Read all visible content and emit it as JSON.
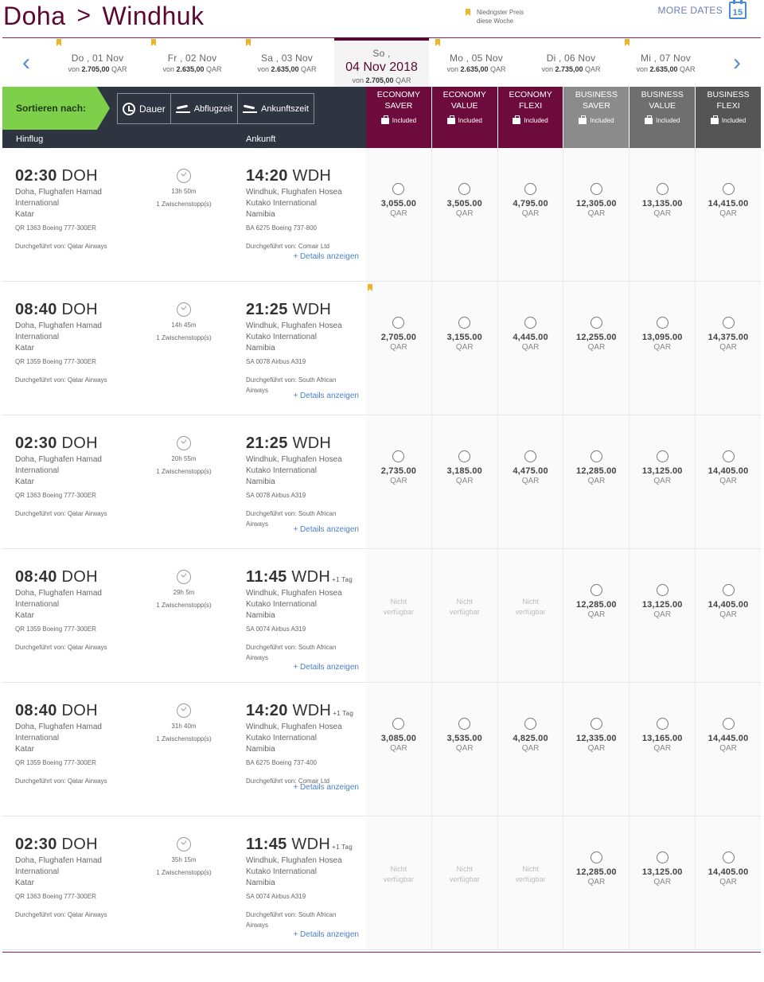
{
  "header": {
    "origin": "Doha",
    "separator": ">",
    "destination": "Windhuk",
    "lowest_price_label_1": "Niedrigster Preis",
    "lowest_price_label_2": "diese Woche",
    "more_dates": "MORE DATES",
    "calendar_day": "15"
  },
  "dates": [
    {
      "day": "Do , 01 Nov",
      "from": "von",
      "price": "2.705,00",
      "cur": "QAR",
      "bookmark": true
    },
    {
      "day": "Fr , 02 Nov",
      "from": "von",
      "price": "2.635,00",
      "cur": "QAR",
      "bookmark": true
    },
    {
      "day": "Sa , 03 Nov",
      "from": "von",
      "price": "2.635,00",
      "cur": "QAR",
      "bookmark": true
    },
    {
      "day": "So ,",
      "big": "04 Nov 2018",
      "from": "von",
      "price": "2.705,00",
      "cur": "QAR",
      "active": true
    },
    {
      "day": "Mo , 05 Nov",
      "from": "von",
      "price": "2.635,00",
      "cur": "QAR",
      "bookmark": true
    },
    {
      "day": "Di , 06 Nov",
      "from": "von",
      "price": "2.735,00",
      "cur": "QAR"
    },
    {
      "day": "Mi , 07 Nov",
      "from": "von",
      "price": "2.635,00",
      "cur": "QAR",
      "bookmark": true
    }
  ],
  "sort": {
    "label": "Sortieren nach:",
    "duration": "Dauer",
    "departure": "Abflugzeit",
    "arrival": "Ankunftszeit",
    "col_outbound": "Hinflug",
    "col_arrival": "Ankunft"
  },
  "fares": [
    {
      "l1": "ECONOMY",
      "l2": "SAVER",
      "inc": "Included",
      "cls": "eco"
    },
    {
      "l1": "ECONOMY",
      "l2": "VALUE",
      "inc": "Included",
      "cls": "eco"
    },
    {
      "l1": "ECONOMY",
      "l2": "FLEXI",
      "inc": "Included",
      "cls": "eco"
    },
    {
      "l1": "BUSINESS",
      "l2": "SAVER",
      "inc": "Included",
      "cls": "bus1"
    },
    {
      "l1": "BUSINESS",
      "l2": "VALUE",
      "inc": "Included",
      "cls": "bus2"
    },
    {
      "l1": "BUSINESS",
      "l2": "FLEXI",
      "inc": "Included",
      "cls": "bus3"
    }
  ],
  "currency": "QAR",
  "not_available_1": "Nicht",
  "not_available_2": "verfügbar",
  "details_label": "+ Details anzeigen",
  "flights": [
    {
      "dep_time": "02:30",
      "dep_code": "DOH",
      "dep_place": [
        "Doha, Flughafen Hamad",
        "International",
        "Katar"
      ],
      "dep_flight": "QR 1363 Boeing 777-300ER",
      "dep_operator": [
        "Durchgeführt von: Qatar Airways"
      ],
      "duration": "13h 50m",
      "stops": "1 Zwischenstopp(s)",
      "arr_time": "14:20",
      "arr_code": "WDH",
      "arr_plus": "",
      "arr_place": [
        "Windhuk, Flughafen Hosea",
        "Kutako International",
        "Namibia"
      ],
      "arr_flight": "BA 6275 Boeing 737-800",
      "arr_operator": [
        "Durchgeführt von: Comair Ltd"
      ],
      "prices": [
        "3,055.00",
        "3,505.00",
        "4,795.00",
        "12,305.00",
        "13,135.00",
        "14,415.00"
      ],
      "bookmark": false
    },
    {
      "dep_time": "08:40",
      "dep_code": "DOH",
      "dep_place": [
        "Doha, Flughafen Hamad",
        "International",
        "Katar"
      ],
      "dep_flight": "QR 1359 Boeing 777-300ER",
      "dep_operator": [
        "Durchgeführt von: Qatar Airways"
      ],
      "duration": "14h 45m",
      "stops": "1 Zwischenstopp(s)",
      "arr_time": "21:25",
      "arr_code": "WDH",
      "arr_plus": "",
      "arr_place": [
        "Windhuk, Flughafen Hosea",
        "Kutako International",
        "Namibia"
      ],
      "arr_flight": "SA 0078 Airbus A319",
      "arr_operator": [
        "Durchgeführt von: South African",
        "Airways"
      ],
      "prices": [
        "2,705.00",
        "3,155.00",
        "4,445.00",
        "12,255.00",
        "13,095.00",
        "14,375.00"
      ],
      "bookmark": true
    },
    {
      "dep_time": "02:30",
      "dep_code": "DOH",
      "dep_place": [
        "Doha, Flughafen Hamad",
        "International",
        "Katar"
      ],
      "dep_flight": "QR 1363 Boeing 777-300ER",
      "dep_operator": [
        "Durchgeführt von: Qatar Airways"
      ],
      "duration": "20h 55m",
      "stops": "1 Zwischenstopp(s)",
      "arr_time": "21:25",
      "arr_code": "WDH",
      "arr_plus": "",
      "arr_place": [
        "Windhuk, Flughafen Hosea",
        "Kutako International",
        "Namibia"
      ],
      "arr_flight": "SA 0078 Airbus A319",
      "arr_operator": [
        "Durchgeführt von: South African",
        "Airways"
      ],
      "prices": [
        "2,735.00",
        "3,185.00",
        "4,475.00",
        "12,285.00",
        "13,125.00",
        "14,405.00"
      ],
      "bookmark": false
    },
    {
      "dep_time": "08:40",
      "dep_code": "DOH",
      "dep_place": [
        "Doha, Flughafen Hamad",
        "International",
        "Katar"
      ],
      "dep_flight": "QR 1359 Boeing 777-300ER",
      "dep_operator": [
        "Durchgeführt von: Qatar Airways"
      ],
      "duration": "29h 5m",
      "stops": "1 Zwischenstopp(s)",
      "arr_time": "11:45",
      "arr_code": "WDH",
      "arr_plus": "+1 Tag",
      "arr_place": [
        "Windhuk, Flughafen Hosea",
        "Kutako International",
        "Namibia"
      ],
      "arr_flight": "SA 0074 Airbus A319",
      "arr_operator": [
        "Durchgeführt von: South African",
        "Airways"
      ],
      "prices": [
        null,
        null,
        null,
        "12,285.00",
        "13,125.00",
        "14,405.00"
      ],
      "bookmark": false
    },
    {
      "dep_time": "08:40",
      "dep_code": "DOH",
      "dep_place": [
        "Doha, Flughafen Hamad",
        "International",
        "Katar"
      ],
      "dep_flight": "QR 1359 Boeing 777-300ER",
      "dep_operator": [
        "Durchgeführt von: Qatar Airways"
      ],
      "duration": "31h 40m",
      "stops": "1 Zwischenstopp(s)",
      "arr_time": "14:20",
      "arr_code": "WDH",
      "arr_plus": "+1 Tag",
      "arr_place": [
        "Windhuk, Flughafen Hosea",
        "Kutako International",
        "Namibia"
      ],
      "arr_flight": "BA 6275 Boeing 737-400",
      "arr_operator": [
        "Durchgeführt von: Comair Ltd"
      ],
      "prices": [
        "3,085.00",
        "3,535.00",
        "4,825.00",
        "12,335.00",
        "13,165.00",
        "14,445.00"
      ],
      "bookmark": false
    },
    {
      "dep_time": "02:30",
      "dep_code": "DOH",
      "dep_place": [
        "Doha, Flughafen Hamad",
        "International",
        "Katar"
      ],
      "dep_flight": "QR 1363 Boeing 777-300ER",
      "dep_operator": [
        "Durchgeführt von: Qatar Airways"
      ],
      "duration": "35h 15m",
      "stops": "1 Zwischenstopp(s)",
      "arr_time": "11:45",
      "arr_code": "WDH",
      "arr_plus": "+1 Tag",
      "arr_place": [
        "Windhuk, Flughafen Hosea",
        "Kutako International",
        "Namibia"
      ],
      "arr_flight": "SA 0074 Airbus A319",
      "arr_operator": [
        "Durchgeführt von: South African",
        "Airways"
      ],
      "prices": [
        null,
        null,
        null,
        "12,285.00",
        "13,125.00",
        "14,405.00"
      ],
      "bookmark": false
    }
  ]
}
